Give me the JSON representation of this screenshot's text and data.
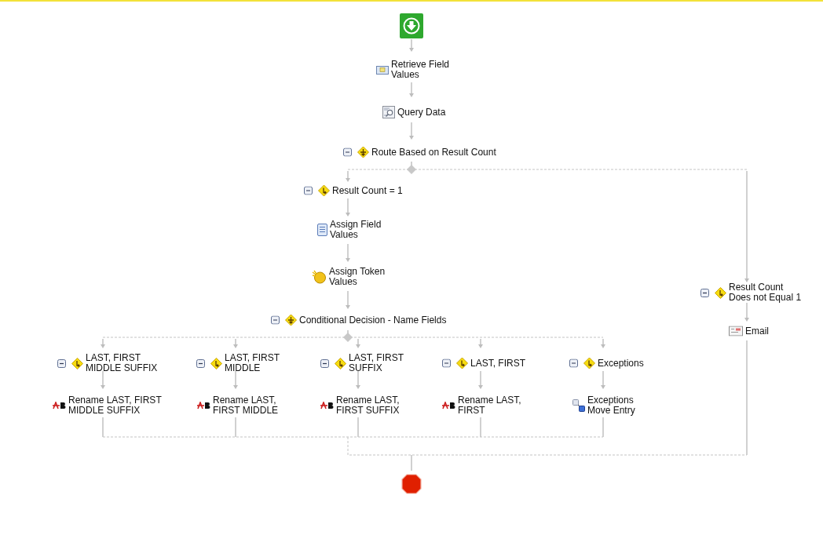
{
  "nodes": [
    {
      "kind": "start"
    },
    {
      "kind": "retrieve",
      "label": "Retrieve Field\nValues"
    },
    {
      "kind": "query",
      "label": "Query Data"
    },
    {
      "kind": "decision",
      "label": "Route Based on Result Count"
    },
    {
      "kind": "condition",
      "label": "Result Count = 1"
    },
    {
      "kind": "assign-fields",
      "label": "Assign Field\nValues"
    },
    {
      "kind": "assign-tokens",
      "label": "Assign Token\nValues"
    },
    {
      "kind": "decision",
      "label": "Conditional Decision - Name Fields"
    },
    {
      "kind": "condition",
      "label": "Result Count\nDoes not Equal 1"
    },
    {
      "kind": "email",
      "label": "Email"
    },
    {
      "kind": "condition",
      "label": "LAST, FIRST\nMIDDLE SUFFIX"
    },
    {
      "kind": "condition",
      "label": "LAST, FIRST\nMIDDLE"
    },
    {
      "kind": "condition",
      "label": "LAST, FIRST\nSUFFIX"
    },
    {
      "kind": "condition",
      "label": "LAST, FIRST"
    },
    {
      "kind": "condition",
      "label": "Exceptions"
    },
    {
      "kind": "rename",
      "label": "Rename LAST, FIRST\nMIDDLE SUFFIX"
    },
    {
      "kind": "rename",
      "label": "Rename LAST,\nFIRST MIDDLE"
    },
    {
      "kind": "rename",
      "label": "Rename LAST,\nFIRST SUFFIX"
    },
    {
      "kind": "rename",
      "label": "Rename LAST,\nFIRST"
    },
    {
      "kind": "move",
      "label": "Exceptions\nMove Entry"
    },
    {
      "kind": "end"
    }
  ]
}
